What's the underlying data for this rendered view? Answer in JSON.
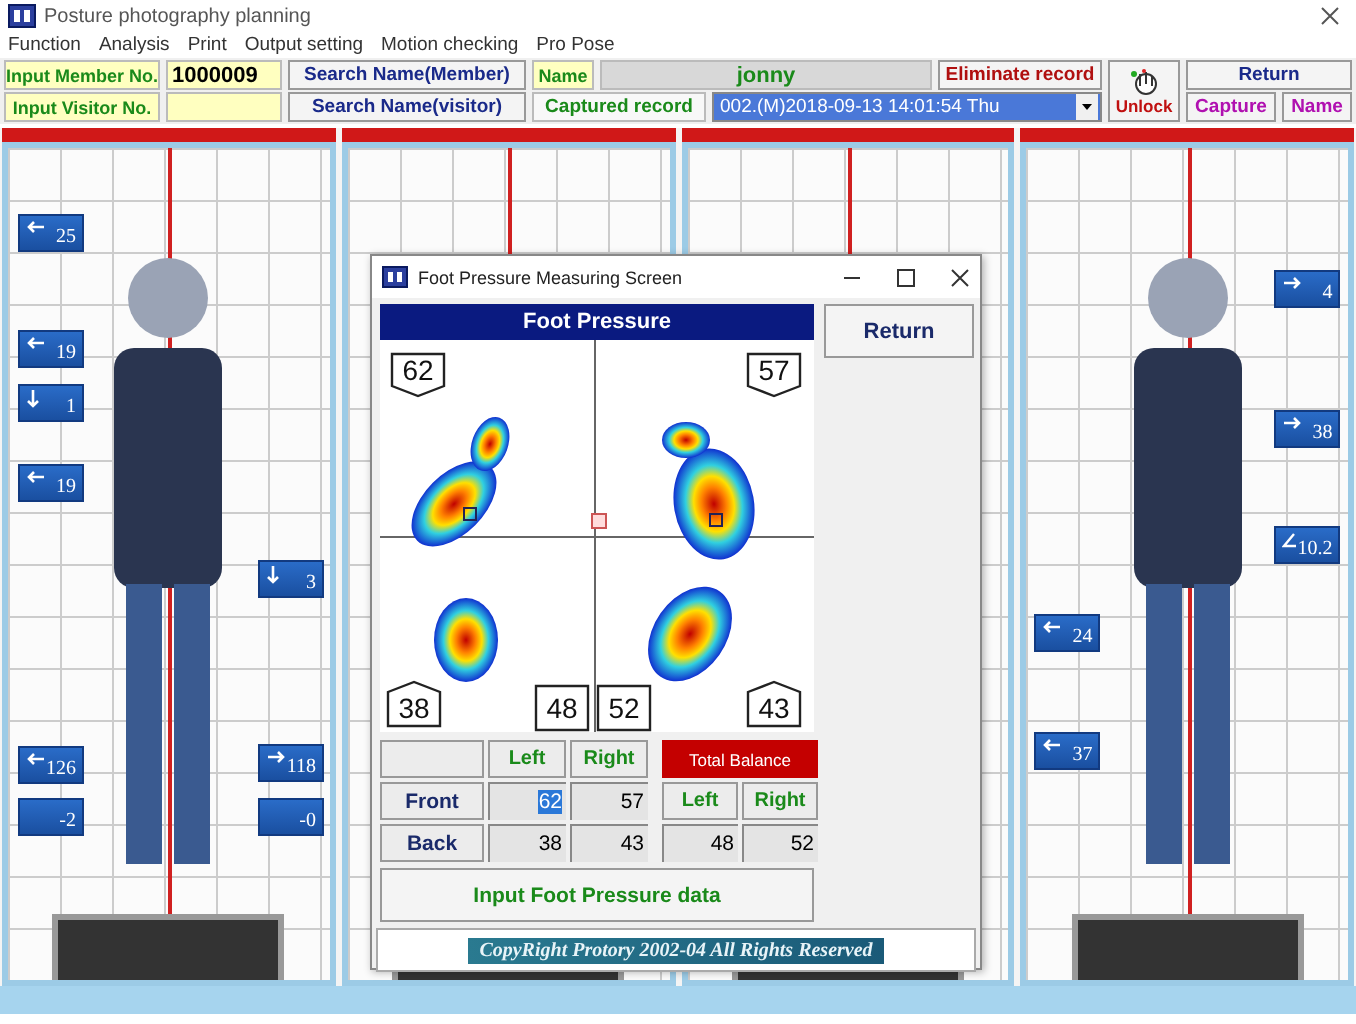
{
  "window": {
    "title": "Posture photography planning",
    "menu": [
      "Function",
      "Analysis",
      "Print",
      "Output setting",
      "Motion checking",
      "Pro Pose"
    ]
  },
  "toolbar": {
    "member_label": "Input Member No.",
    "member_value": "1000009",
    "visitor_label": "Input Visitor No.",
    "search_member": "Search Name(Member)",
    "search_visitor": "Search Name(visitor)",
    "name_label": "Name",
    "name_value": "jonny",
    "captured_record": "Captured record",
    "record": "002.(M)2018-09-13 14:01:54 Thu",
    "eliminate": "Eliminate record",
    "unlock": "Unlock",
    "return": "Return",
    "capture": "Capture",
    "name_button": "Name"
  },
  "panels": [
    {
      "kind": "marked",
      "badges": [
        {
          "kind": "left",
          "text": "25"
        },
        {
          "kind": "left",
          "text": "19"
        },
        {
          "kind": "down",
          "text": "1"
        },
        {
          "kind": "left",
          "text": "19"
        },
        {
          "kind": "down",
          "text": "3"
        },
        {
          "kind": "left",
          "text": "126"
        },
        {
          "kind": "right",
          "text": "118"
        },
        {
          "kind": "plain",
          "text": "-2"
        },
        {
          "kind": "plain",
          "text": "-0"
        }
      ]
    },
    {
      "kind": "plain"
    },
    {
      "kind": "plain"
    },
    {
      "kind": "marked",
      "badges": [
        {
          "kind": "right",
          "text": "4"
        },
        {
          "kind": "right",
          "text": "38"
        },
        {
          "kind": "angle",
          "text": "10.2"
        },
        {
          "kind": "left",
          "text": "24"
        },
        {
          "kind": "left",
          "text": "37"
        }
      ]
    }
  ],
  "dialog": {
    "title": "Foot Pressure Measuring Screen",
    "header": "Foot Pressure",
    "return": "Return",
    "readings": [
      {
        "text": "62",
        "kind": "down"
      },
      {
        "text": "57",
        "kind": "down"
      },
      {
        "text": "38",
        "kind": "up"
      },
      {
        "text": "48",
        "kind": "flat"
      },
      {
        "text": "52",
        "kind": "flat"
      },
      {
        "text": "43",
        "kind": "up"
      }
    ],
    "columns": [
      "Left",
      "Right"
    ],
    "rows": [
      {
        "label": "Front",
        "values": [
          {
            "text": "62",
            "selected": true
          },
          {
            "text": "57",
            "selected": false
          }
        ]
      },
      {
        "label": "Back",
        "values": [
          {
            "text": "38",
            "selected": false
          },
          {
            "text": "43",
            "selected": false
          }
        ]
      }
    ],
    "balance": {
      "title": "Total Balance",
      "columns": [
        "Left",
        "Right"
      ],
      "values": [
        "48",
        "52"
      ]
    },
    "input_button": "Input Foot Pressure data",
    "copyright": "CopyRight Protory 2002-04 All Rights Reserved"
  }
}
